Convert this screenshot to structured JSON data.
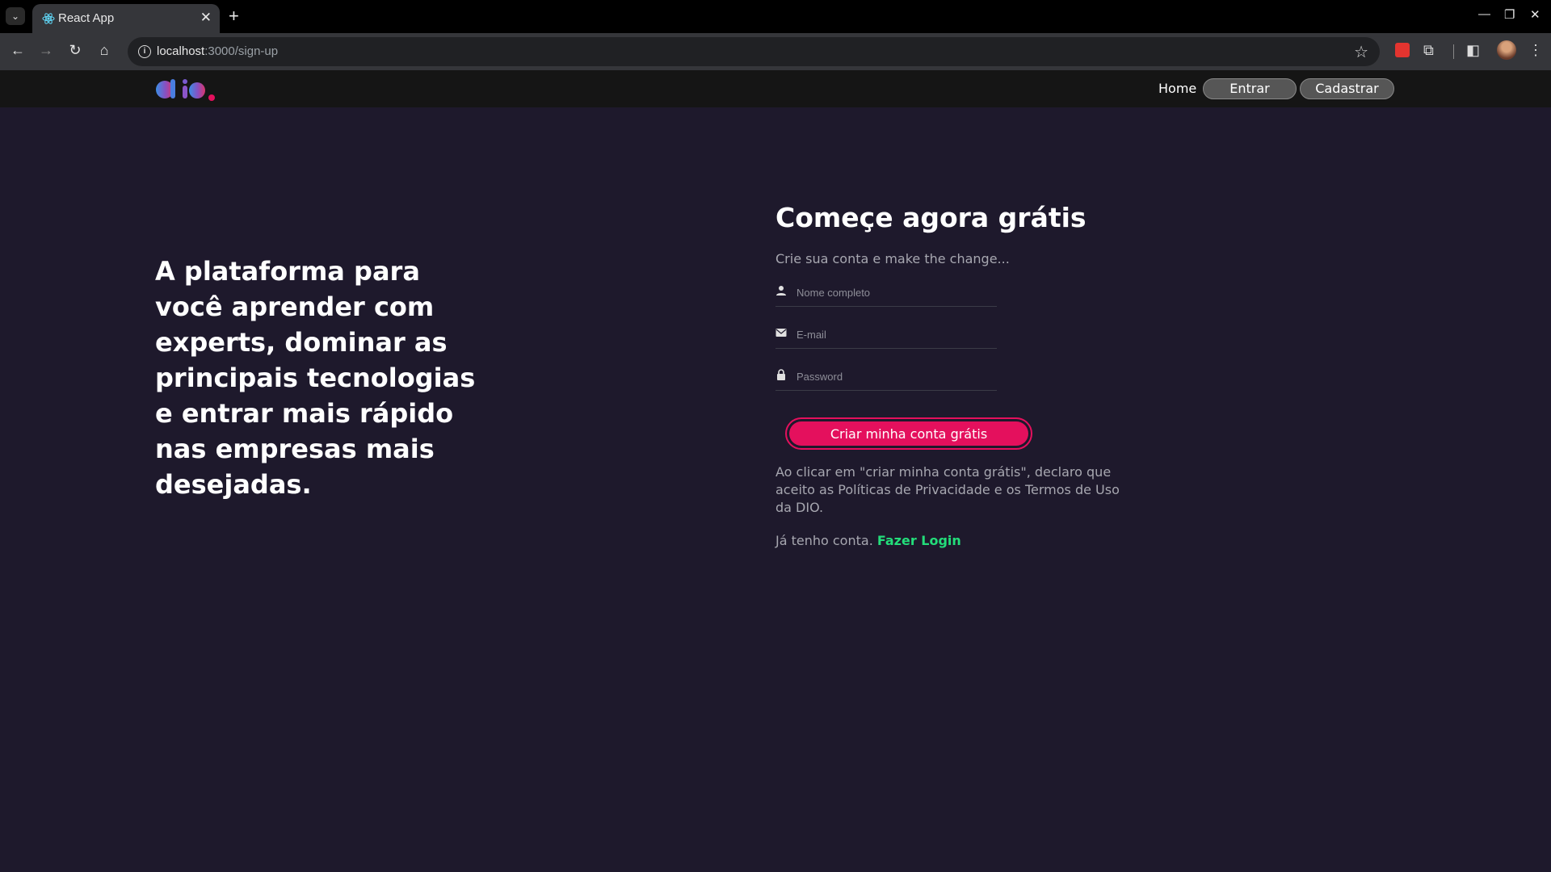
{
  "browser": {
    "tab_title": "React App",
    "url_host": "localhost",
    "url_path": ":3000/sign-up",
    "icons": [
      "tab-search-icon",
      "react-favicon",
      "close-icon",
      "plus-icon",
      "minimize-icon",
      "restore-icon",
      "close-window-icon",
      "back-icon",
      "forward-icon",
      "reload-icon",
      "home-icon",
      "info-icon",
      "star-icon",
      "extension-icon",
      "puzzle-icon",
      "sidepanel-icon",
      "avatar",
      "more-icon"
    ]
  },
  "header": {
    "nav_home": "Home",
    "login_button": "Entrar",
    "signup_button": "Cadastrar"
  },
  "hero": {
    "text": "A plataforma para você aprender com experts, dominar as principais tecnologias e entrar mais rápido nas empresas mais desejadas."
  },
  "form": {
    "title": "Começe agora grátis",
    "subtitle": "Crie sua conta e make the change...",
    "name_placeholder": "Nome completo",
    "email_placeholder": "E-mail",
    "password_placeholder": "Password",
    "submit_label": "Criar minha conta grátis",
    "terms": "Ao clicar em \"criar minha conta grátis\", declaro que aceito as Políticas de Privacidade e os Termos de Uso da DIO.",
    "login_prompt": "Já tenho conta.",
    "login_link": "Fazer Login"
  },
  "colors": {
    "background": "#1e192c",
    "header": "#151515",
    "accent": "#e4105d",
    "link": "#23dd7a"
  }
}
